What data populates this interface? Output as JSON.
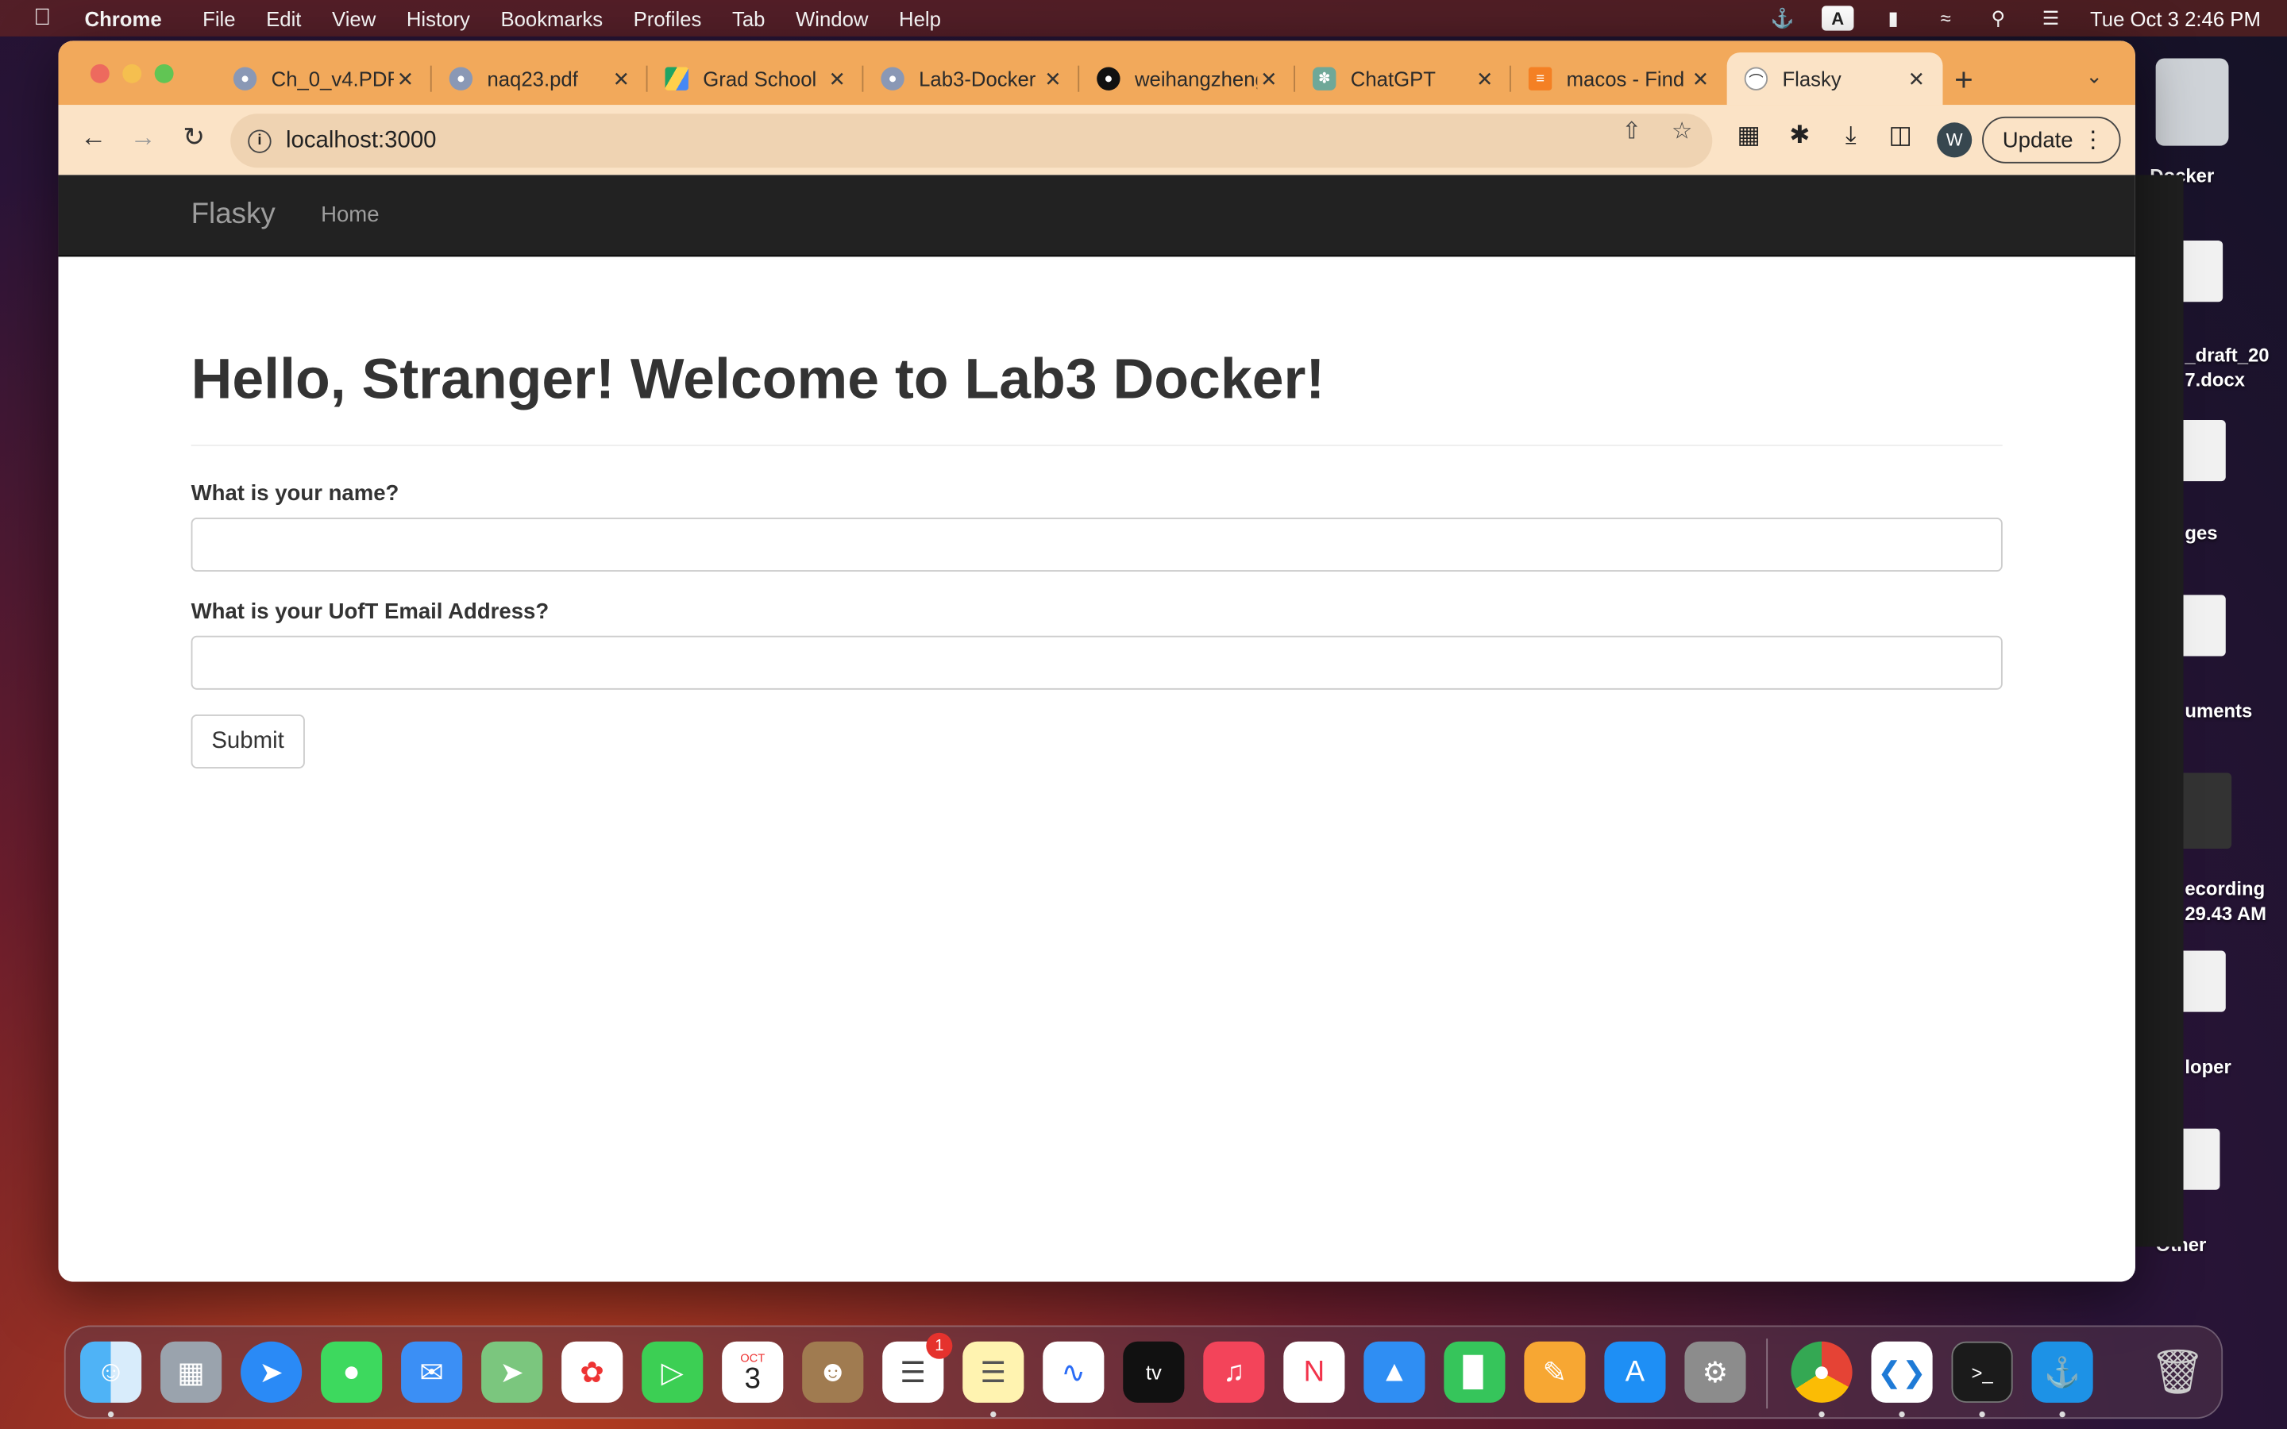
{
  "menubar": {
    "app_name": "Chrome",
    "items": [
      "File",
      "Edit",
      "View",
      "History",
      "Bookmarks",
      "Profiles",
      "Tab",
      "Window",
      "Help"
    ],
    "keyboard_indicator": "A",
    "datetime": "Tue Oct 3  2:46 PM"
  },
  "tabs": [
    {
      "title": "Ch_0_v4.PDF",
      "favicon": "globe-icon"
    },
    {
      "title": "naq23.pdf",
      "favicon": "globe-icon"
    },
    {
      "title": "Grad School",
      "favicon": "drive-icon"
    },
    {
      "title": "Lab3-Docker",
      "favicon": "globe-icon"
    },
    {
      "title": "weihangzheng",
      "favicon": "github-icon"
    },
    {
      "title": "ChatGPT",
      "favicon": "chatgpt-icon"
    },
    {
      "title": "macos - Find",
      "favicon": "stackoverflow-icon"
    },
    {
      "title": "Flasky",
      "favicon": "flasky-icon",
      "active": true
    }
  ],
  "toolbar": {
    "url": "localhost:3000",
    "profile_initial": "W",
    "update_label": "Update"
  },
  "page": {
    "brand": "Flasky",
    "nav_home": "Home",
    "heading": "Hello, Stranger! Welcome to Lab3 Docker!",
    "name_label": "What is your name?",
    "email_label": "What is your UofT Email Address?",
    "submit_label": "Submit"
  },
  "desktop": {
    "labels": [
      "Docker",
      "_draft_20",
      "7.docx",
      "ges",
      "uments",
      "ecording",
      "29.43 AM",
      "loper",
      "Other"
    ]
  },
  "dock": {
    "calendar_month": "OCT",
    "calendar_day": "3",
    "reminders_badge": "1"
  },
  "colors": {
    "tabstrip": "#f2a95b",
    "toolbar": "#fbe3c6",
    "navbar": "#222222"
  }
}
